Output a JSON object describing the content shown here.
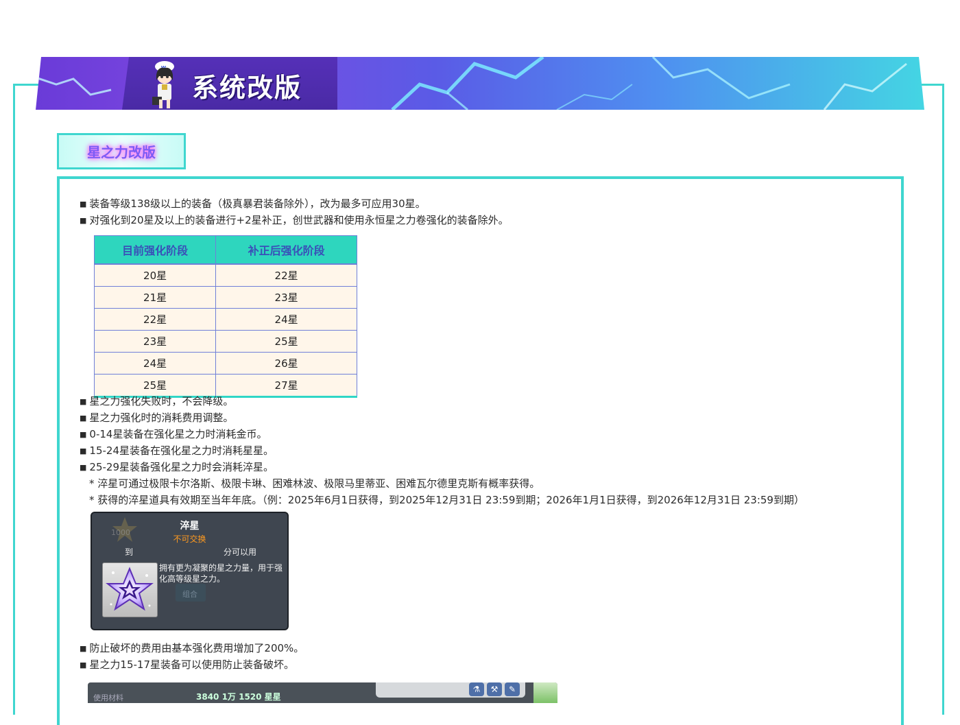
{
  "banner": {
    "title": "系统改版"
  },
  "section": {
    "tag": "星之力改版"
  },
  "lines": {
    "l1": "装备等级138级以上的装备（极真暴君装备除外），改为最多可应用30星。",
    "l2": "对强化到20星及以上的装备进行+2星补正，创世武器和使用永恒星之力卷强化的装备除外。",
    "l3": "星之力强化失败时，不会降级。",
    "l4": "星之力强化时的消耗费用调整。",
    "l5": "0-14星装备在强化星之力时消耗金币。",
    "l6": "15-24星装备在强化星之力时消耗星星。",
    "l7": "25-29星装备强化星之力时会消耗淬星。",
    "n1": "* 淬星可通过极限卡尔洛斯、极限卡琳、困难林波、极限马里蒂亚、困难瓦尔德里克斯有概率获得。",
    "n2": "* 获得的淬星道具有效期至当年年底。（例：2025年6月1日获得，到2025年12月31日 23:59到期；2026年1月1日获得，到2026年12月31日 23:59到期）",
    "l8": "防止破坏的费用由基本强化费用增加了200%。",
    "l9": "星之力15-17星装备可以使用防止装备破坏。"
  },
  "bullet": "■",
  "table": {
    "headers": [
      "目前强化阶段",
      "补正后强化阶段"
    ],
    "rows": [
      [
        "20星",
        "22星"
      ],
      [
        "21星",
        "23星"
      ],
      [
        "22星",
        "24星"
      ],
      [
        "23星",
        "25星"
      ],
      [
        "24星",
        "26星"
      ],
      [
        "25星",
        "27星"
      ]
    ]
  },
  "tooltip": {
    "title": "淬星",
    "subtitle": "不可交换",
    "ghost_number": "1000",
    "left_text": "到",
    "right_text": "分可以用",
    "desc": "拥有更为凝聚的星之力量，用于强化高等级星之力。",
    "ghost_button": "组合"
  },
  "game_strip": {
    "left_label": "使用材料",
    "numbers": "3840  1万  1520  星星"
  },
  "colors": {
    "accent": "#3fd6cf",
    "table_header": "#2ed6be",
    "table_border": "#6f7fd8"
  }
}
